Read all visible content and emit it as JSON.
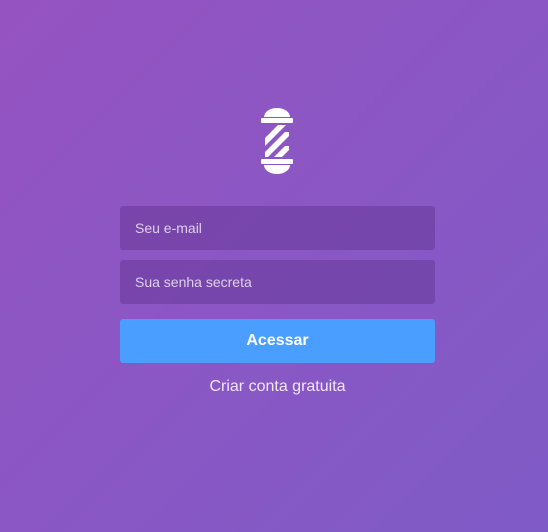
{
  "logo": {
    "icon": "barber-pole-icon"
  },
  "login_form": {
    "email_placeholder": "Seu e-mail",
    "password_placeholder": "Sua senha secreta",
    "submit_label": "Acessar",
    "create_account_label": "Criar conta gratuita"
  },
  "colors": {
    "background_start": "#9553c1",
    "background_end": "#7f5bc7",
    "button": "#4a9eff",
    "text": "#ffffff"
  }
}
